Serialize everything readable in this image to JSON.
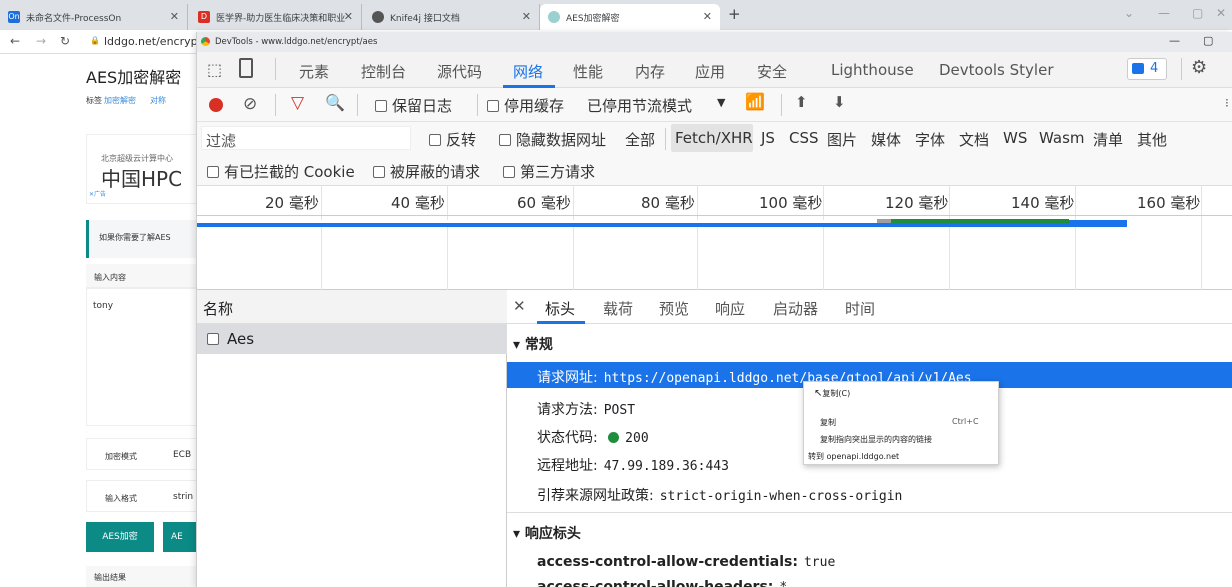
{
  "browser": {
    "tabs": [
      {
        "icon": "On",
        "title": "未命名文件-ProcessOn"
      },
      {
        "icon": "D",
        "title": "医学界-助力医生临床决策和职业..."
      },
      {
        "icon": "",
        "title": "Knife4j 接口文档"
      },
      {
        "icon": "",
        "title": "AES加密解密"
      }
    ],
    "new_tab": "+",
    "address": "lddgo.net/encryp"
  },
  "page": {
    "heading": "AES加密解密",
    "tags_label": "标签",
    "tag1": "加密解密",
    "tag2": "对称",
    "ad_line": "北京超级云计算中心",
    "ad_big": "中国HPC",
    "ad_mark": "✕广告",
    "info": "如果你需要了解AES",
    "input_label": "输入内容",
    "input_value": "tony",
    "mode_label": "加密模式",
    "mode_value": "ECB",
    "format_label": "输入格式",
    "format_value": "strin",
    "encrypt_btn": "AES加密",
    "decrypt_btn": "AE",
    "output_label": "输出结果"
  },
  "devtools": {
    "title": "DevTools - www.lddgo.net/encrypt/aes",
    "tabs": [
      "元素",
      "控制台",
      "源代码",
      "网络",
      "性能",
      "内存",
      "应用",
      "安全",
      "Lighthouse",
      "Devtools Styler"
    ],
    "issues_count": "4",
    "toolbar": {
      "preserve_log": "保留日志",
      "disable_cache": "停用缓存",
      "throttle": "已停用节流模式"
    },
    "filter": {
      "placeholder": "过滤",
      "invert": "反转",
      "hide_data": "隐藏数据网址",
      "all": "全部",
      "types": [
        "Fetch/XHR",
        "JS",
        "CSS",
        "图片",
        "媒体",
        "字体",
        "文档",
        "WS",
        "Wasm",
        "清单",
        "其他"
      ],
      "blocked_cookies": "有已拦截的 Cookie",
      "blocked_requests": "被屏蔽的请求",
      "third_party": "第三方请求"
    },
    "timeline_ticks": [
      "20 毫秒",
      "40 毫秒",
      "60 毫秒",
      "80 毫秒",
      "100 毫秒",
      "120 毫秒",
      "140 毫秒",
      "160 毫秒"
    ],
    "list": {
      "header": "名称",
      "rows": [
        "Aes"
      ]
    },
    "detail_tabs": [
      "标头",
      "载荷",
      "预览",
      "响应",
      "启动器",
      "时间"
    ],
    "general": {
      "title": "常规",
      "request_url_key": "请求网址:",
      "request_url_value": "https://openapi.lddgo.net/base/gtool/api/v1/Aes",
      "method_key": "请求方法:",
      "method_value": "POST",
      "status_key": "状态代码:",
      "status_value": "200",
      "remote_key": "远程地址:",
      "remote_value": "47.99.189.36:443",
      "referrer_key": "引荐来源网址政策:",
      "referrer_value": "strict-origin-when-cross-origin"
    },
    "response_headers": {
      "title": "响应标头",
      "h1_key": "access-control-allow-credentials:",
      "h1_value": "true",
      "h2_key": "access-control-allow-headers:",
      "h2_value": "*"
    },
    "context_menu": {
      "items": [
        "复制(C)",
        "复制",
        "复制指向突出显示的内容的链接",
        "转到 openapi.lddgo.net"
      ],
      "shortcut": "Ctrl+C"
    }
  },
  "colors": {
    "accent": "#1a73e8",
    "teal": "#0b8a86",
    "record_red": "#d93025",
    "status_green": "#1e8e3e",
    "selected_row": "#1a73e8"
  }
}
